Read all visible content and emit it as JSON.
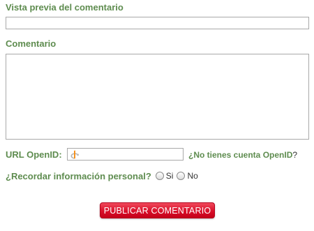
{
  "form": {
    "preview_label": "Vista previa del comentario",
    "comment_label": "Comentario",
    "comment_value": "",
    "openid": {
      "label": "URL OpenID:",
      "value": "",
      "help_link": "¿No tienes cuenta OpenID",
      "help_suffix": "?"
    },
    "remember": {
      "label": "¿Recordar información personal?",
      "option_yes": "Si",
      "option_no": "No"
    },
    "submit_label": "PUBLICAR COMENTARIO"
  },
  "colors": {
    "label_green": "#5e8c4f",
    "button_red": "#d9102a",
    "openid_orange": "#f7931e"
  },
  "icons": {
    "openid": "openid-icon"
  }
}
